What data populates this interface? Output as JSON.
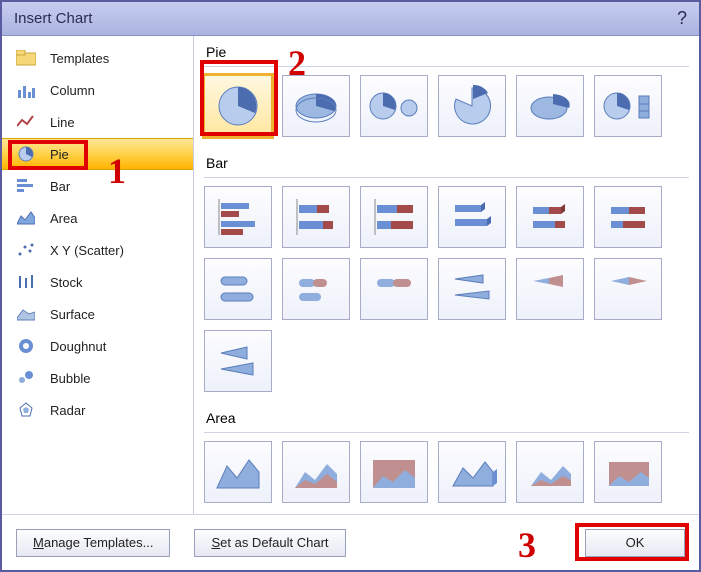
{
  "title": "Insert Chart",
  "help": "?",
  "categories": [
    {
      "id": "templates",
      "label": "Templates"
    },
    {
      "id": "column",
      "label": "Column"
    },
    {
      "id": "line",
      "label": "Line"
    },
    {
      "id": "pie",
      "label": "Pie"
    },
    {
      "id": "bar",
      "label": "Bar"
    },
    {
      "id": "area",
      "label": "Area"
    },
    {
      "id": "scatter",
      "label": "X Y (Scatter)"
    },
    {
      "id": "stock",
      "label": "Stock"
    },
    {
      "id": "surface",
      "label": "Surface"
    },
    {
      "id": "doughnut",
      "label": "Doughnut"
    },
    {
      "id": "bubble",
      "label": "Bubble"
    },
    {
      "id": "radar",
      "label": "Radar"
    }
  ],
  "selected_category": "pie",
  "sections": {
    "pie": {
      "label": "Pie",
      "thumbs": [
        "pie",
        "pie-3d",
        "pie-of-pie",
        "pie-exploded",
        "pie-exploded-3d",
        "bar-of-pie"
      ]
    },
    "bar": {
      "label": "Bar",
      "thumbs": [
        "bar-clustered",
        "bar-stacked",
        "bar-100",
        "bar-3d-clustered",
        "bar-3d-stacked",
        "bar-3d-100",
        "bar-cyl-clustered",
        "bar-cyl-stacked",
        "bar-cyl-100",
        "bar-cone-clustered",
        "bar-cone-stacked",
        "bar-cone-100",
        "bar-pyr-clustered"
      ]
    },
    "area": {
      "label": "Area",
      "thumbs": [
        "area",
        "area-stacked",
        "area-100",
        "area-3d",
        "area-3d-stacked",
        "area-3d-100"
      ]
    }
  },
  "selected_thumb": "pie",
  "footer": {
    "manage": {
      "pre": "M",
      "rest": "anage Templates..."
    },
    "default": {
      "pre": "S",
      "rest": "et as Default Chart"
    },
    "ok": "OK"
  },
  "annotations": {
    "n1": "1",
    "n2": "2",
    "n3": "3"
  }
}
